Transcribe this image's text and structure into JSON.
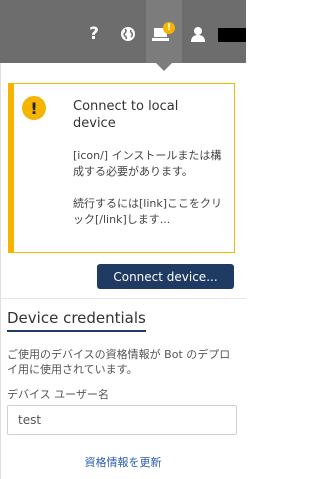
{
  "topbar": {
    "icons": [
      "help-icon",
      "globe-icon",
      "device-icon",
      "user-icon"
    ],
    "help_glyph": "?",
    "notification_badge": "!",
    "bg_color": "#6d6d6d"
  },
  "alert": {
    "icon": "!",
    "title": "Connect to local device",
    "body_line1": "[icon/] インストールまたは構成する必要があります。",
    "body_line2": "続行するには[link]ここをクリック[/link]します...",
    "accent_color": "#f4b400"
  },
  "connect_button": {
    "label": "Connect device..."
  },
  "credentials": {
    "title": "Device credentials",
    "description": "ご使用のデバイスの資格情報が Bot のデプロイ用に使用されています。",
    "username_label": "デバイス ユーザー名",
    "username_value": "test",
    "update_link": "資格情報を更新"
  },
  "colors": {
    "primary": "#1f3b63",
    "link": "#2a5db0"
  }
}
